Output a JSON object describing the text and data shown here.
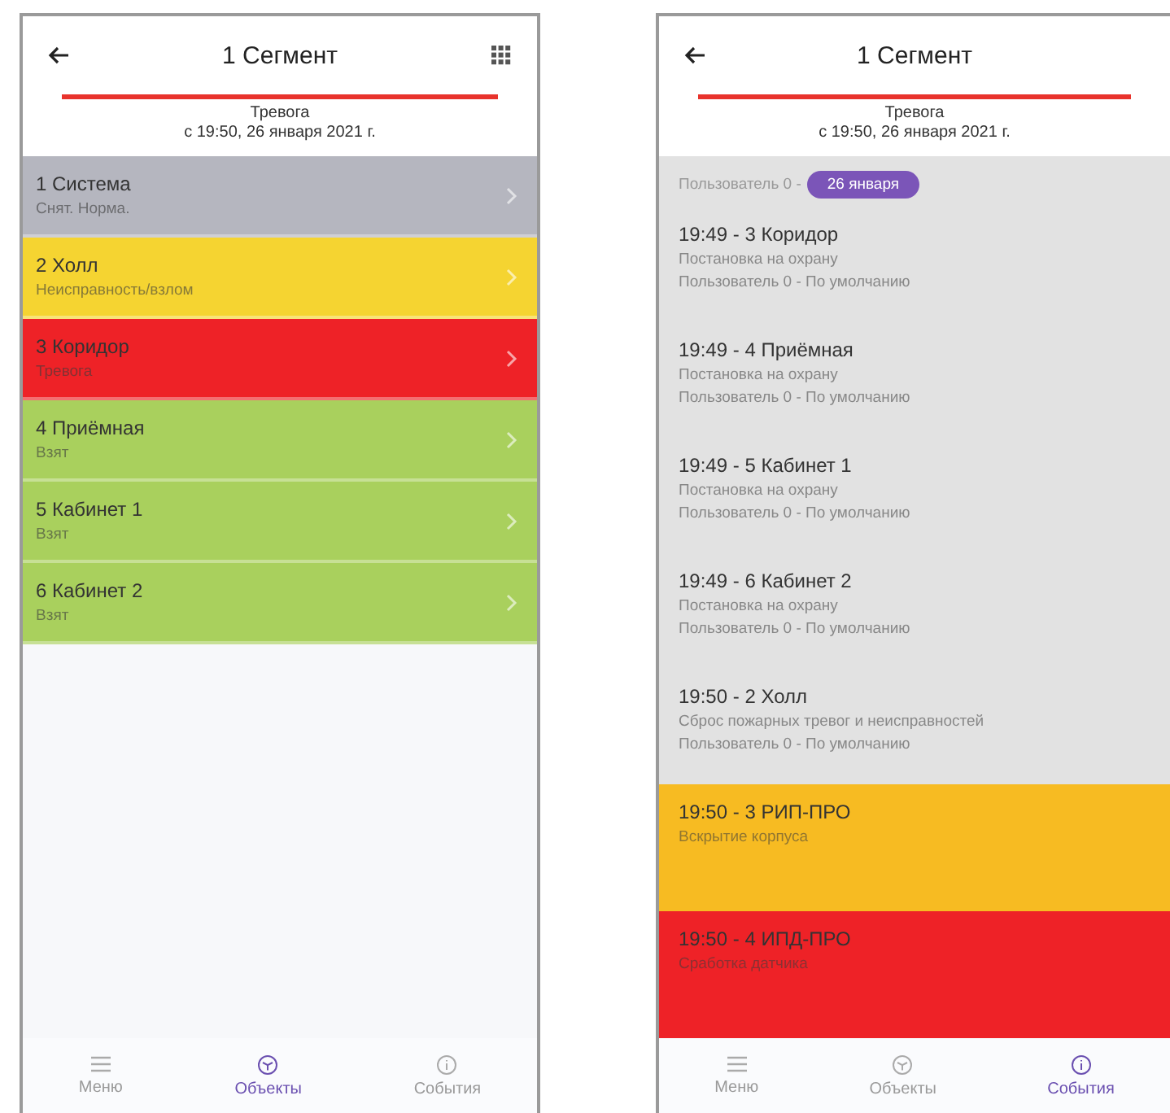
{
  "left_screen": {
    "title": "1 Сегмент",
    "status": {
      "label": "Тревога",
      "since": "с 19:50, 26 января 2021 г.",
      "color": "#e8332c"
    },
    "zones": [
      {
        "name": "1 Система",
        "state": "Снят. Норма.",
        "color": "#b5b6bf"
      },
      {
        "name": "2 Холл",
        "state": "Неисправность/взлом",
        "color": "#f5d431"
      },
      {
        "name": "3 Коридор",
        "state": "Тревога",
        "color": "#ee2227"
      },
      {
        "name": "4 Приёмная",
        "state": "Взят",
        "color": "#a9d05d"
      },
      {
        "name": "5 Кабинет 1",
        "state": "Взят",
        "color": "#a9d05d"
      },
      {
        "name": "6 Кабинет 2",
        "state": "Взят",
        "color": "#a9d05d"
      }
    ],
    "nav": [
      {
        "label": "Меню",
        "kind": "menu",
        "selected": false
      },
      {
        "label": "Объекты",
        "kind": "objects",
        "selected": true
      },
      {
        "label": "События",
        "kind": "events",
        "selected": false
      }
    ]
  },
  "right_screen": {
    "title": "1 Сегмент",
    "status": {
      "label": "Тревога",
      "since": "с 19:50, 26 января 2021 г.",
      "color": "#e8332c"
    },
    "partial_line": "Пользователь 0 -",
    "date_badge": "26 января",
    "events": [
      {
        "title": "19:49 - 3 Коридор",
        "lines": [
          "Постановка на охрану",
          "Пользователь 0 - По умолчанию"
        ],
        "color": "#e2e2e2"
      },
      {
        "title": "19:49 - 4 Приёмная",
        "lines": [
          "Постановка на охрану",
          "Пользователь 0 - По умолчанию"
        ],
        "color": "#e2e2e2"
      },
      {
        "title": "19:49 - 5 Кабинет 1",
        "lines": [
          "Постановка на охрану",
          "Пользователь 0 - По умолчанию"
        ],
        "color": "#e2e2e2"
      },
      {
        "title": "19:49 - 6 Кабинет 2",
        "lines": [
          "Постановка на охрану",
          "Пользователь 0 - По умолчанию"
        ],
        "color": "#e2e2e2"
      },
      {
        "title": "19:50 - 2 Холл",
        "lines": [
          "Сброс пожарных тревог и неисправностей",
          "Пользователь 0 - По умолчанию"
        ],
        "color": "#e2e2e2"
      },
      {
        "title": "19:50 - 3 РИП-ПРО",
        "lines": [
          "Вскрытие корпуса"
        ],
        "color": "#f7bb22"
      },
      {
        "title": "19:50 - 4 ИПД-ПРО",
        "lines": [
          "Сработка датчика"
        ],
        "color": "#ee2227"
      }
    ],
    "nav": [
      {
        "label": "Меню",
        "kind": "menu",
        "selected": false
      },
      {
        "label": "Объекты",
        "kind": "objects",
        "selected": false
      },
      {
        "label": "События",
        "kind": "events",
        "selected": true
      }
    ]
  }
}
